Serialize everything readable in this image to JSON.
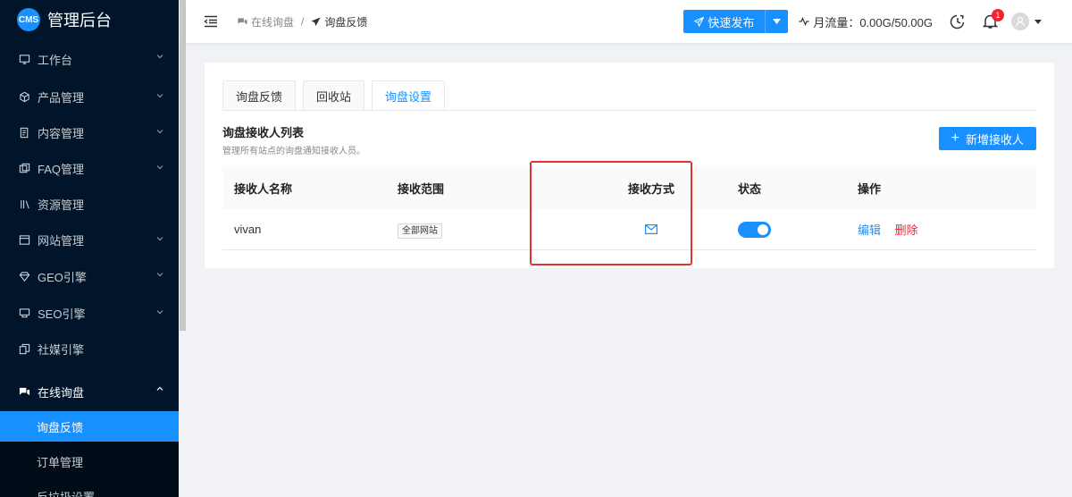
{
  "sidebar": {
    "logo_badge": "CMS",
    "logo_text": "管理后台",
    "items": [
      {
        "label": "工作台",
        "icon": "monitor-icon"
      },
      {
        "label": "产品管理",
        "icon": "cube-icon"
      },
      {
        "label": "内容管理",
        "icon": "document-icon"
      },
      {
        "label": "FAQ管理",
        "icon": "faq-icon"
      },
      {
        "label": "资源管理",
        "icon": "folder-icon"
      },
      {
        "label": "网站管理",
        "icon": "window-icon"
      },
      {
        "label": "GEO引擎",
        "icon": "diamond-icon"
      },
      {
        "label": "SEO引擎",
        "icon": "seo-icon"
      },
      {
        "label": "社媒引擎",
        "icon": "copy-icon"
      },
      {
        "label": "在线询盘",
        "icon": "chat-icon"
      }
    ],
    "sub_items": [
      "询盘反馈",
      "订单管理",
      "反垃圾设置"
    ]
  },
  "header": {
    "breadcrumb": [
      "在线询盘",
      "询盘反馈"
    ],
    "breadcrumb_sep": "/",
    "publish_label": "快速发布",
    "traffic_text": "月流量：0.00G/50.00G",
    "notification_count": "1"
  },
  "main": {
    "tabs": [
      "询盘反馈",
      "回收站",
      "询盘设置"
    ],
    "section_title": "询盘接收人列表",
    "section_desc": "管理所有站点的询盘通知接收人员。",
    "add_button": "新增接收人",
    "columns": [
      "接收人名称",
      "接收范围",
      "接收方式",
      "状态",
      "操作"
    ],
    "rows": [
      {
        "name": "vivan",
        "scope": "全部网站",
        "method_icon": "mail-icon",
        "status": "on",
        "actions": [
          "编辑",
          "删除"
        ]
      }
    ]
  },
  "colors": {
    "primary": "#1890ff",
    "sidebar_bg": "#001529",
    "danger": "#f5222d",
    "highlight_box": "#e5312f"
  }
}
